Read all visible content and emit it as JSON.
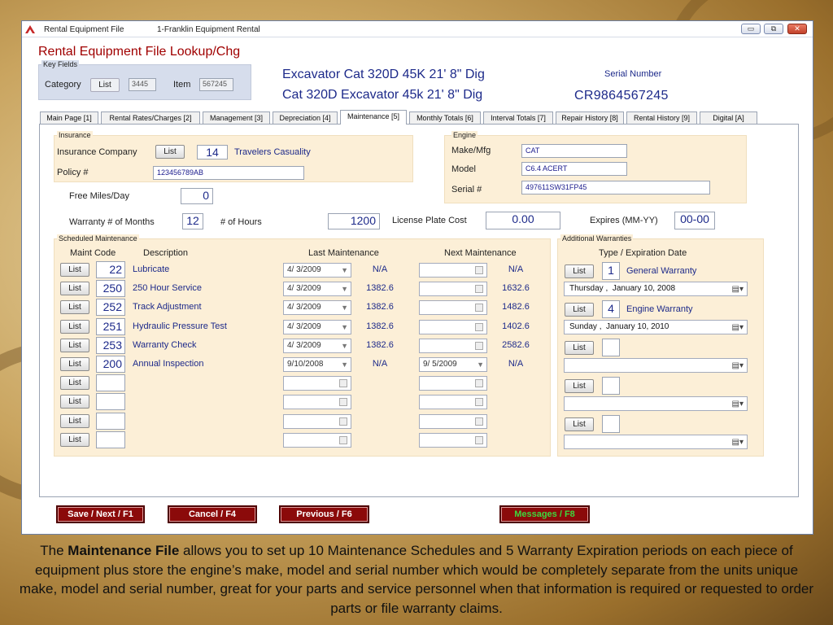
{
  "window": {
    "title": "Rental Equipment File",
    "subtitle": "1-Franklin Equipment Rental",
    "controls": {
      "minimize": "▭",
      "restore": "⧉",
      "close": "✕"
    }
  },
  "app_title": "Rental Equipment File Lookup/Chg",
  "key_fields": {
    "legend": "Key Fields",
    "category_label": "Category",
    "list_label": "List",
    "category_value": "3445",
    "item_label": "Item",
    "item_value": "567245"
  },
  "header": {
    "description1": "Excavator Cat 320D 45K 21' 8\" Dig",
    "description2": "Cat 320D Excavator 45k 21' 8\" Dig",
    "serial_label": "Serial Number",
    "serial_value": "CR9864567245"
  },
  "tabs": [
    "Main Page [1]",
    "Rental Rates/Charges [2]",
    "Management [3]",
    "Depreciation [4]",
    "Maintenance [5]",
    "Monthly Totals [6]",
    "Interval Totals [7]",
    "Repair History [8]",
    "Rental History [9]",
    "Digital [A]"
  ],
  "insurance": {
    "legend": "Insurance",
    "company_label": "Insurance Company",
    "list_label": "List",
    "company_code": "14",
    "company_name": "Travelers Casuality",
    "policy_label": "Policy #",
    "policy_value": "123456789AB"
  },
  "engine": {
    "legend": "Engine",
    "make_label": "Make/Mfg",
    "make_value": "CAT",
    "model_label": "Model",
    "model_value": "C6.4 ACERT",
    "serial_label": "Serial #",
    "serial_value": "497611SW31FP45"
  },
  "misc": {
    "free_miles_label": "Free Miles/Day",
    "free_miles_value": "0",
    "warranty_months_label": "Warranty # of Months",
    "warranty_months_value": "12",
    "hours_label": "# of   Hours",
    "hours_value": "1200",
    "license_label": "License Plate Cost",
    "license_value": "0.00",
    "expires_label": "Expires (MM-YY)",
    "expires_value": "00-00"
  },
  "scheduled": {
    "legend": "Scheduled Maintenance",
    "col_code": "Maint Code",
    "col_desc": "Description",
    "col_last": "Last Maintenance",
    "col_next": "Next Maintenance",
    "list_label": "List",
    "rows": [
      {
        "code": "22",
        "desc": "Lubricate",
        "last_date": "4/  3/2009",
        "last_val": "N/A",
        "next_date": "",
        "next_val": "N/A"
      },
      {
        "code": "250",
        "desc": "250 Hour Service",
        "last_date": "4/  3/2009",
        "last_val": "1382.6",
        "next_date": "",
        "next_val": "1632.6"
      },
      {
        "code": "252",
        "desc": "Track Adjustment",
        "last_date": "4/  3/2009",
        "last_val": "1382.6",
        "next_date": "",
        "next_val": "1482.6"
      },
      {
        "code": "251",
        "desc": "Hydraulic Pressure Test",
        "last_date": "4/  3/2009",
        "last_val": "1382.6",
        "next_date": "",
        "next_val": "1402.6"
      },
      {
        "code": "253",
        "desc": "Warranty Check",
        "last_date": "4/  3/2009",
        "last_val": "1382.6",
        "next_date": "",
        "next_val": "2582.6"
      },
      {
        "code": "200",
        "desc": "Annual Inspection",
        "last_date": "9/10/2008",
        "last_val": "N/A",
        "next_date": "9/  5/2009",
        "next_val": "N/A"
      },
      {
        "code": "",
        "desc": "",
        "last_date": "",
        "last_val": "",
        "next_date": "",
        "next_val": ""
      },
      {
        "code": "",
        "desc": "",
        "last_date": "",
        "last_val": "",
        "next_date": "",
        "next_val": ""
      },
      {
        "code": "",
        "desc": "",
        "last_date": "",
        "last_val": "",
        "next_date": "",
        "next_val": ""
      },
      {
        "code": "",
        "desc": "",
        "last_date": "",
        "last_val": "",
        "next_date": "",
        "next_val": ""
      }
    ]
  },
  "warranties": {
    "legend": "Additional Warranties",
    "col_header": "Type / Expiration Date",
    "list_label": "List",
    "items": [
      {
        "code": "1",
        "type": "General Warranty",
        "weekday": "Thursday",
        "sep": ",",
        "date": "January  10, 2008"
      },
      {
        "code": "4",
        "type": "Engine Warranty",
        "weekday": "Sunday",
        "sep": ",",
        "date": "January  10, 2010"
      },
      {
        "code": "",
        "type": "",
        "weekday": "",
        "sep": "",
        "date": ""
      },
      {
        "code": "",
        "type": "",
        "weekday": "",
        "sep": "",
        "date": ""
      },
      {
        "code": "",
        "type": "",
        "weekday": "",
        "sep": "",
        "date": ""
      }
    ]
  },
  "buttons": {
    "save": "Save / Next / F1",
    "cancel": "Cancel / F4",
    "previous": "Previous / F6",
    "messages": "Messages / F8"
  },
  "caption": {
    "bold": "Maintenance File",
    "lead": "The",
    "text": "allows you to set up 10 Maintenance Schedules and 5 Warranty Expiration periods on each piece of equipment plus store the engine’s make, model and serial number which would be completely separate from the units unique make, model and serial number, great for your parts and service personnel when that information is required or requested to order parts or file warranty claims."
  },
  "icons": {
    "dropdown": "dropdown-arrow-icon",
    "calendar": "calendar-icon",
    "app_logo": "app-logo-icon"
  },
  "colors": {
    "title_red": "#a00000",
    "text_blue": "#1d2a8a",
    "panel_bg": "#fcefd7",
    "button_red": "#8b0a0a",
    "messages_green": "#3dd83d"
  }
}
